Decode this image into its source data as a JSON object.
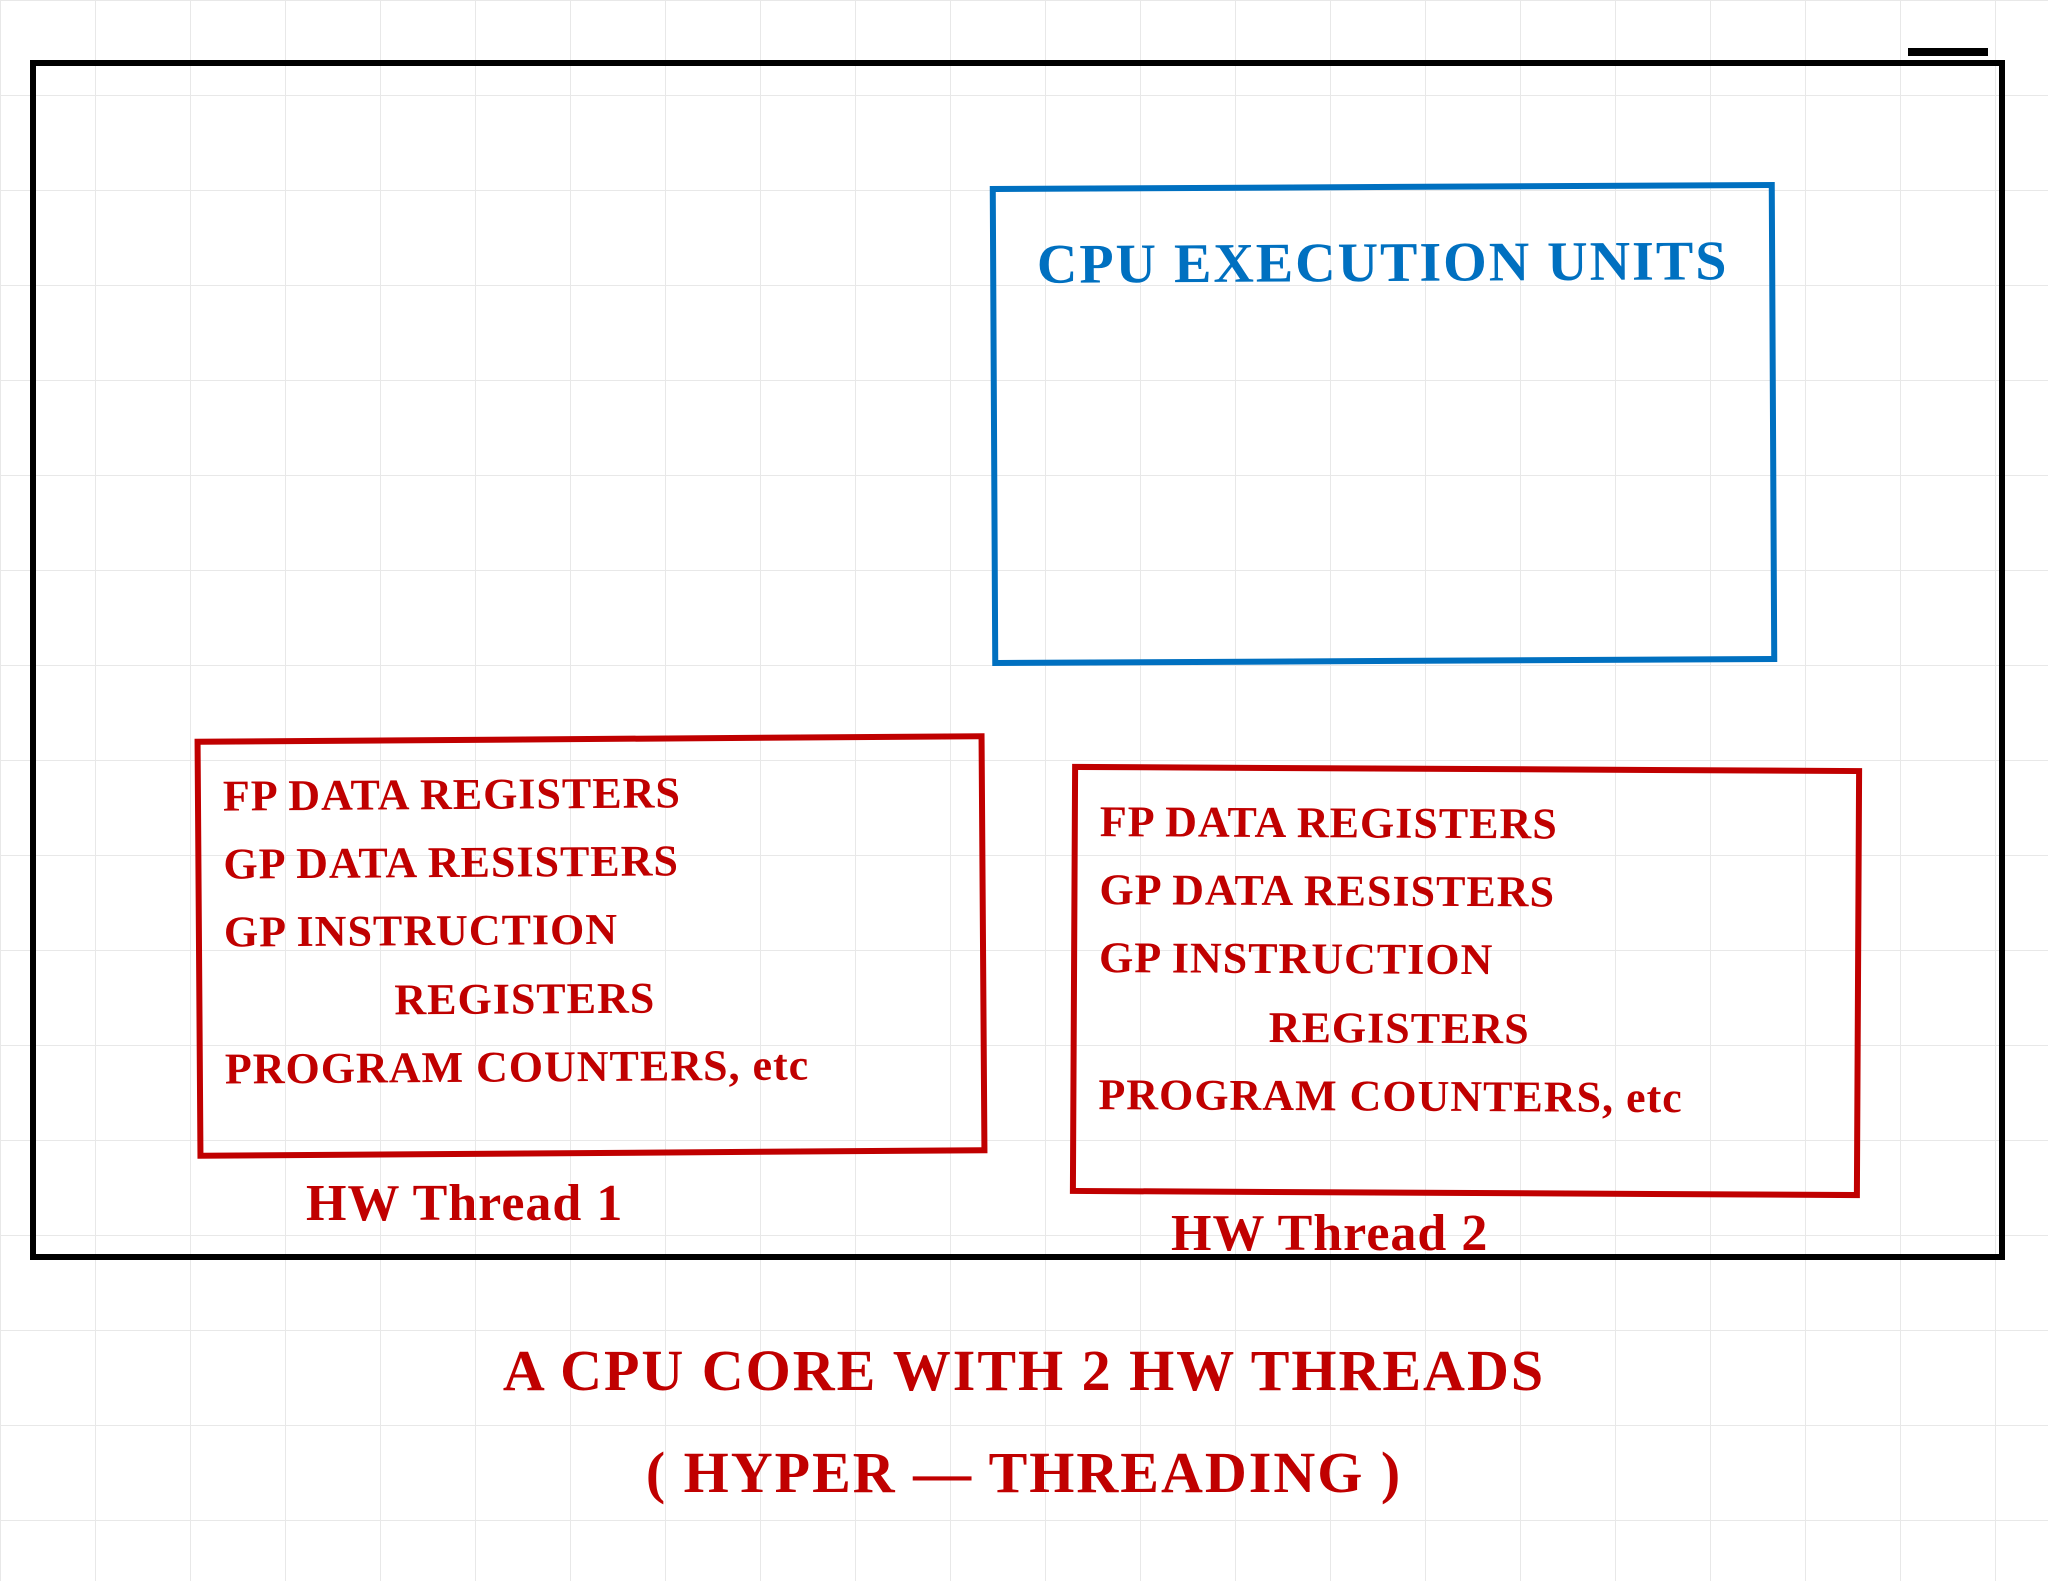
{
  "colors": {
    "border_black": "#000000",
    "blue": "#0070c0",
    "red": "#c00000",
    "grid": "#e8e8e8"
  },
  "exec_units": {
    "line1": "CPU",
    "line2": "EXECUTION",
    "line3": "UNITS"
  },
  "thread1": {
    "line1": "FP DATA REGISTERS",
    "line2": "GP DATA RESISTERS",
    "line3": "GP INSTRUCTION",
    "line4": "REGISTERS",
    "line5": "PROGRAM COUNTERS, etc",
    "label": "HW Thread 1"
  },
  "thread2": {
    "line1": "FP DATA REGISTERS",
    "line2": "GP DATA RESISTERS",
    "line3": "GP INSTRUCTION",
    "line4": "REGISTERS",
    "line5": "PROGRAM COUNTERS, etc",
    "label": "HW Thread 2"
  },
  "caption": {
    "line1": "A CPU CORE  WITH  2 HW THREADS",
    "line2": "( HYPER — THREADING )"
  }
}
